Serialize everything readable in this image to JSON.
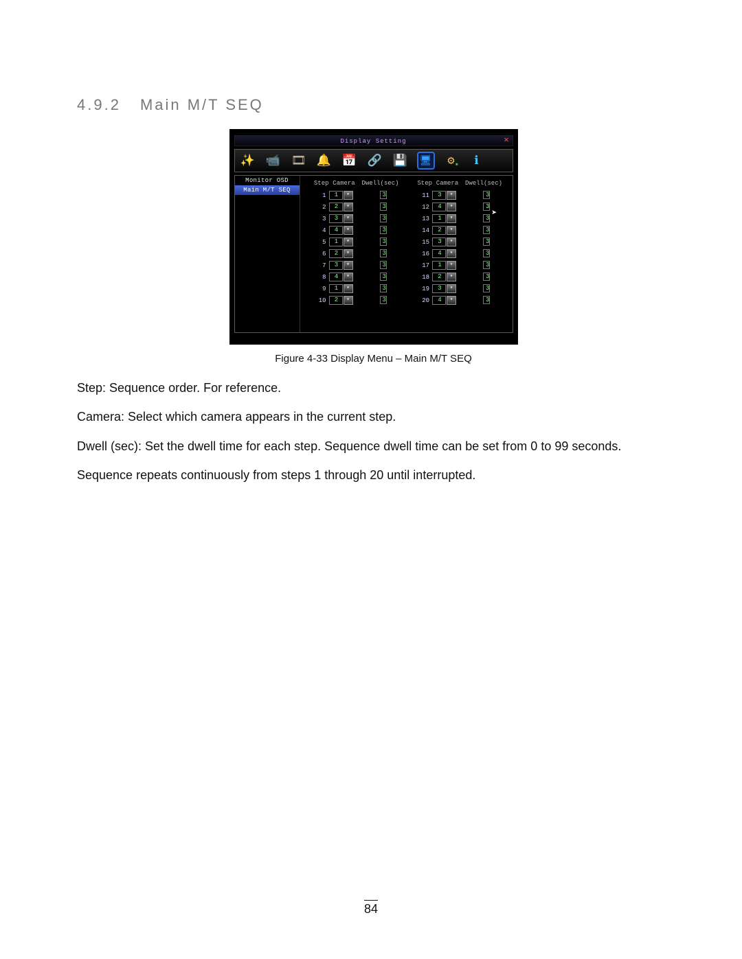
{
  "heading": {
    "number": "4.9.2",
    "title": "Main M/T SEQ"
  },
  "dialog": {
    "title": "Display Setting",
    "close_label": "✕",
    "toolbar": {
      "wand": "✨",
      "cam": "📹",
      "reel": "🎞",
      "bell": "🔔",
      "sched": "📅",
      "net": "🔗",
      "disk": "💾",
      "display": "🖥",
      "gear": "⚙",
      "info": "ℹ"
    },
    "sidebar": {
      "item0": "Monitor OSD",
      "item1": "Main M/T SEQ"
    },
    "headers": {
      "step": "Step",
      "camera": "Camera",
      "dwell": "Dwell(sec)"
    },
    "rows_left": [
      {
        "step": "1",
        "cam": "1",
        "dwell": "3"
      },
      {
        "step": "2",
        "cam": "2",
        "dwell": "3"
      },
      {
        "step": "3",
        "cam": "3",
        "dwell": "3"
      },
      {
        "step": "4",
        "cam": "4",
        "dwell": "3"
      },
      {
        "step": "5",
        "cam": "1",
        "dwell": "3"
      },
      {
        "step": "6",
        "cam": "2",
        "dwell": "3"
      },
      {
        "step": "7",
        "cam": "3",
        "dwell": "3"
      },
      {
        "step": "8",
        "cam": "4",
        "dwell": "3"
      },
      {
        "step": "9",
        "cam": "1",
        "dwell": "3"
      },
      {
        "step": "10",
        "cam": "2",
        "dwell": "3"
      }
    ],
    "rows_right": [
      {
        "step": "11",
        "cam": "3",
        "dwell": "3"
      },
      {
        "step": "12",
        "cam": "4",
        "dwell": "3"
      },
      {
        "step": "13",
        "cam": "1",
        "dwell": "3"
      },
      {
        "step": "14",
        "cam": "2",
        "dwell": "3"
      },
      {
        "step": "15",
        "cam": "3",
        "dwell": "3"
      },
      {
        "step": "16",
        "cam": "4",
        "dwell": "3"
      },
      {
        "step": "17",
        "cam": "1",
        "dwell": "3"
      },
      {
        "step": "18",
        "cam": "2",
        "dwell": "3"
      },
      {
        "step": "19",
        "cam": "3",
        "dwell": "3"
      },
      {
        "step": "20",
        "cam": "4",
        "dwell": "3"
      }
    ],
    "dropdown_glyph": "▾"
  },
  "caption": "Figure 4-33  Display Menu – Main M/T SEQ",
  "paragraphs": {
    "p1_lead": "Step:",
    "p1_rest": " Sequence order. For reference.",
    "p2_lead": "Camera:",
    "p2_rest": " Select which camera appears in the current step.",
    "p3_lead": "Dwell (sec):",
    "p3_rest": " Set the dwell time for each step. Sequence dwell time can be set from 0 to 99 seconds.",
    "p4": "Sequence repeats continuously from steps 1 through 20 until interrupted."
  },
  "page_number": "84"
}
